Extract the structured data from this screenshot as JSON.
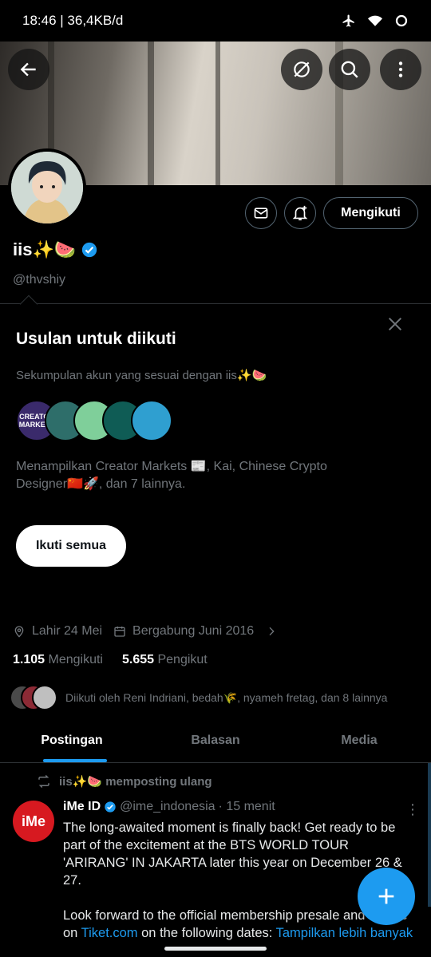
{
  "status_bar": {
    "time_speed": "18:46 | 36,4KB/d",
    "icons": [
      "airplane-icon",
      "wifi-icon",
      "battery-icon"
    ]
  },
  "profile": {
    "name": "iis✨🍉",
    "handle": "@thvshiy",
    "follow_button": "Mengikuti"
  },
  "suggestions": {
    "title": "Usulan untuk diikuti",
    "subtitle": "Sekumpulan akun yang sesuai dengan iis✨🍉",
    "avatar_text": "CREATOR MARKETS",
    "description": "Menampilkan Creator Markets 📰, Kai, Chinese Crypto Designer🇨🇳🚀, dan 7 lainnya.",
    "follow_all": "Ikuti semua"
  },
  "meta": {
    "birthday": "Lahir 24 Mei",
    "joined": "Bergabung Juni 2016"
  },
  "counts": {
    "following_num": "1.105",
    "following_label": "Mengikuti",
    "followers_num": "5.655",
    "followers_label": "Pengikut"
  },
  "followed_by": "Diikuti oleh Reni Indriani, bedah🌾, nyameh fretag, dan 8 lainnya",
  "tabs": [
    "Postingan",
    "Balasan",
    "Media"
  ],
  "post": {
    "repost_label": "iis✨🍉 memposting ulang",
    "avatar_text": "iMe",
    "author": "iMe ID",
    "handle": "@ime_indonesia",
    "time": "· 15 menit",
    "text1": "The long-awaited moment is finally back! Get ready to be part of the excitement at the BTS WORLD TOUR 'ARIRANG' IN JAKARTA later this year on December 26 & 27.",
    "text2_a": "Look forward to the official membership presale and onsale on ",
    "text2_link": "Tiket.com",
    "text2_b": " on the following dates: ",
    "show_more": "Tampilkan lebih banyak"
  },
  "colors": {
    "accent": "#1d9bf0",
    "background": "#000000",
    "muted": "#71767b"
  }
}
